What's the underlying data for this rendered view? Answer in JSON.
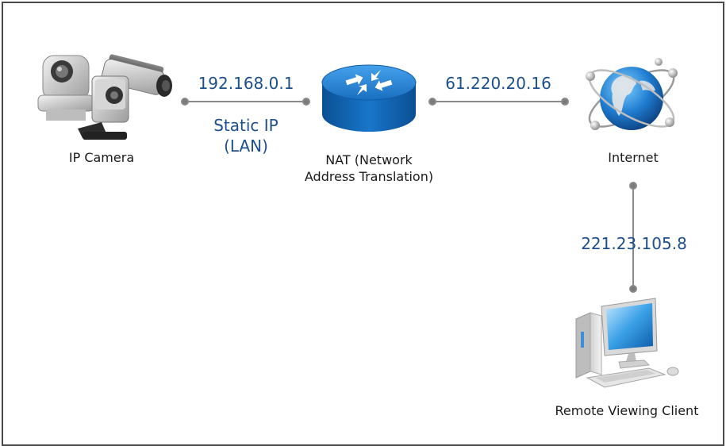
{
  "nodes": {
    "camera": {
      "label": "IP Camera"
    },
    "nat": {
      "label_line1": "NAT (Network",
      "label_line2": "Address Translation)"
    },
    "internet": {
      "label": "Internet"
    },
    "client": {
      "label": "Remote Viewing Client"
    }
  },
  "links": {
    "camera_nat": {
      "ip": "192.168.0.1",
      "note_line1": "Static IP",
      "note_line2": "(LAN)"
    },
    "nat_internet": {
      "ip": "61.220.20.16"
    },
    "internet_client": {
      "ip": "221.23.105.8"
    }
  },
  "colors": {
    "ip_text": "#1c4f8c",
    "wire": "#8a8a8a",
    "router": "#1976c9"
  }
}
